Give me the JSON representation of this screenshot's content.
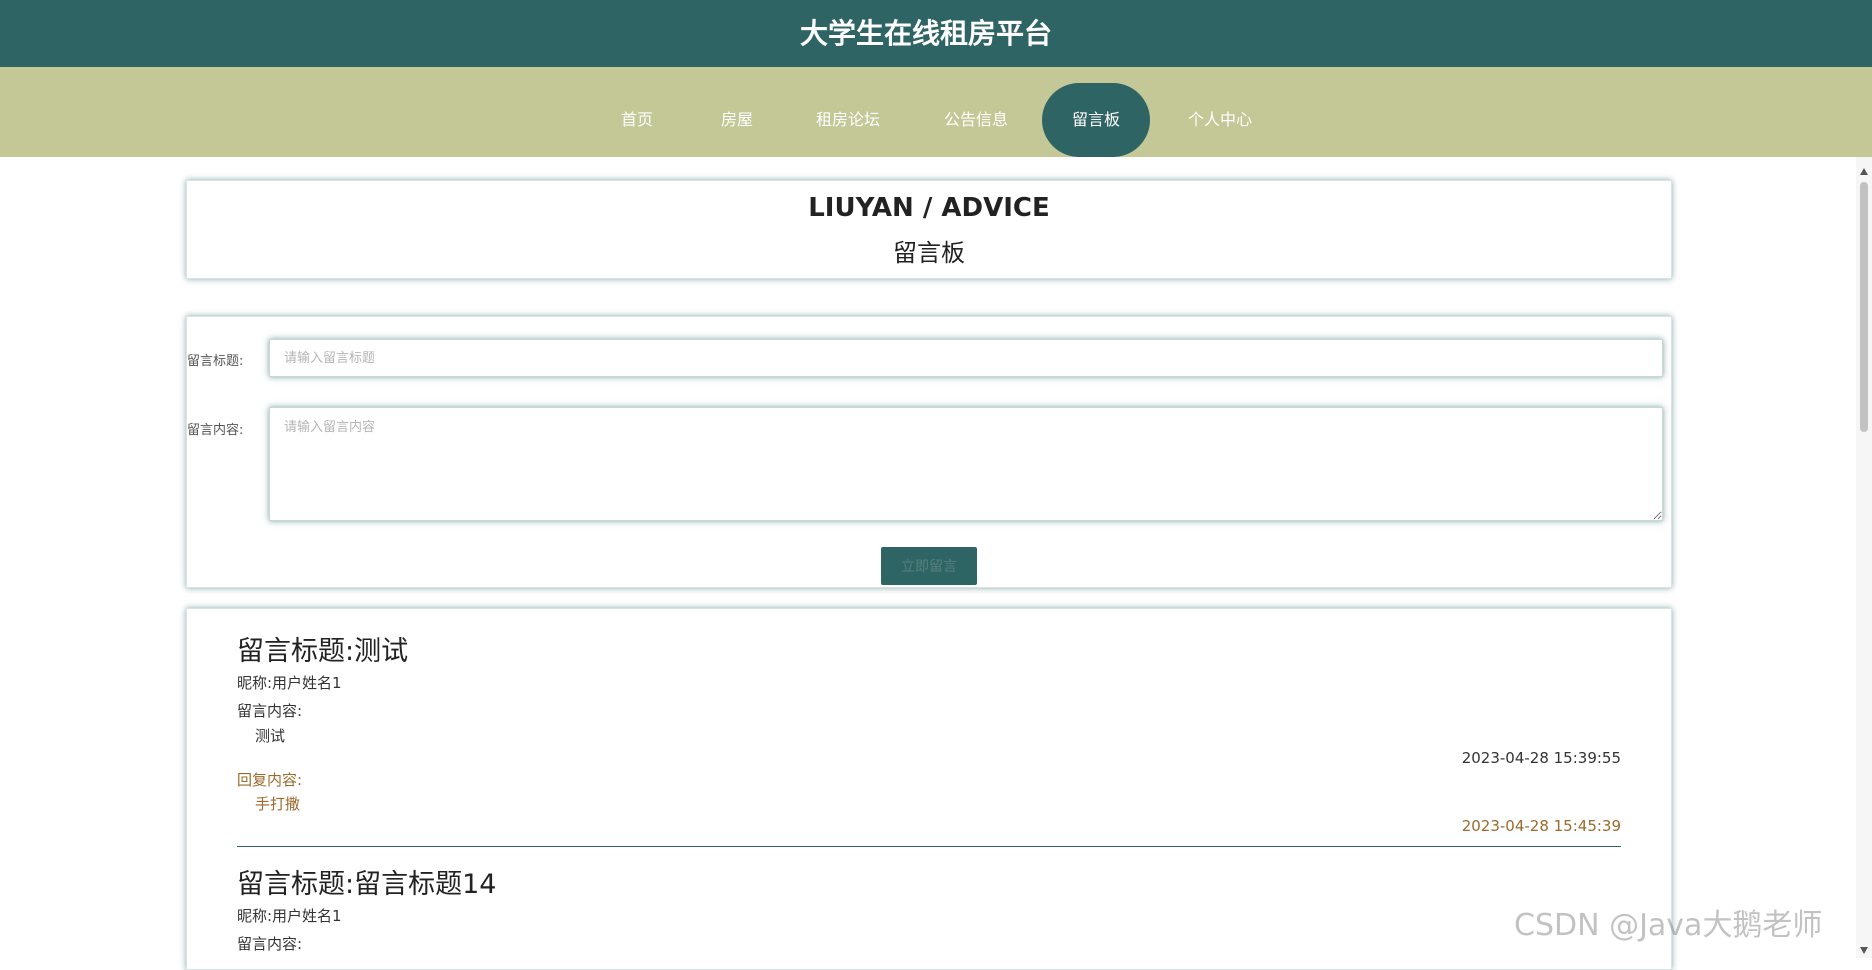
{
  "site": {
    "title": "大学生在线租房平台"
  },
  "nav": {
    "items": [
      {
        "label": "首页"
      },
      {
        "label": "房屋"
      },
      {
        "label": "租房论坛"
      },
      {
        "label": "公告信息"
      },
      {
        "label": "留言板"
      },
      {
        "label": "个人中心"
      }
    ],
    "active_index": 4,
    "active_bg": "#2f6464"
  },
  "heading": {
    "en": "LIUYAN / ADVICE",
    "cn": "留言板"
  },
  "form": {
    "title_label": "留言标题:",
    "title_placeholder": "请输入留言标题",
    "title_value": "",
    "content_label": "留言内容:",
    "content_placeholder": "请输入留言内容",
    "content_value": "",
    "submit_label": "立即留言"
  },
  "messages": [
    {
      "title": "留言标题:测试",
      "nickname": "昵称:用户姓名1",
      "content_label": "留言内容:",
      "content": "测试",
      "time": "2023-04-28 15:39:55",
      "reply_label": "回复内容:",
      "reply": "手打撒",
      "reply_time": "2023-04-28 15:45:39"
    },
    {
      "title": "留言标题:留言标题14",
      "nickname": "昵称:用户姓名1",
      "content_label": "留言内容:"
    }
  ],
  "watermark": "CSDN @Java大鹅老师",
  "colors": {
    "primary": "#2f6464",
    "nav_bg": "#c4c796",
    "reply": "#9b6a2c"
  }
}
